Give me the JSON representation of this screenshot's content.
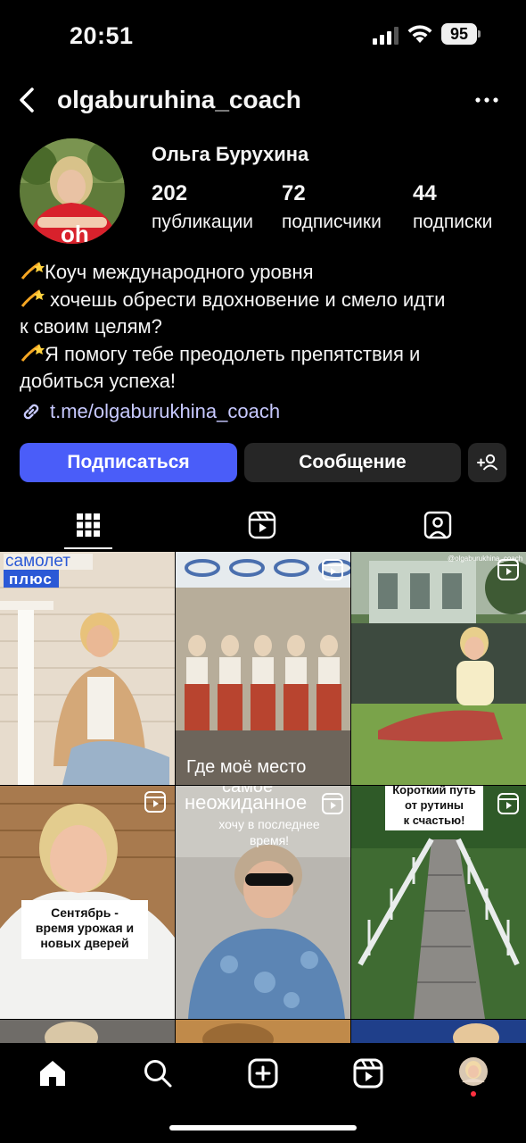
{
  "status": {
    "time": "20:51",
    "battery": "95"
  },
  "header": {
    "username": "olgaburuhina_coach"
  },
  "profile": {
    "name": "Ольга Бурухина",
    "stats": [
      {
        "value": "202",
        "label": "публикации"
      },
      {
        "value": "72",
        "label": "подписчики"
      },
      {
        "value": "44",
        "label": "подписки"
      }
    ],
    "bio": [
      "Коуч международного уровня",
      " хочешь обрести вдохновение и смело идти",
      "к своим целям?",
      "Я помогу тебе преодолеть препятствия и",
      "добиться успеха!"
    ],
    "bio_emoji": "dizzy-star-icon",
    "link": "t.me/olgaburukhina_coach"
  },
  "actions": {
    "follow": "Подписаться",
    "message": "Сообщение"
  },
  "tabs": [
    "grid-icon",
    "reels-icon",
    "tagged-icon"
  ],
  "grid": {
    "captions": {
      "c1_line1": "самолет",
      "c1_line2": "плюс",
      "c2": "Где моё место",
      "c3_watermark": "@olgaburukhina_coach",
      "c4": [
        "Сентябрь -",
        "время урожая и",
        "новых дверей"
      ],
      "c5_title": "самое",
      "c5_word": "неожиданное",
      "c5_sub": [
        "хочу  в  последнее",
        "время!"
      ],
      "c6": [
        "Короткий путь",
        "от рутины",
        "к счастью!"
      ]
    }
  },
  "colors": {
    "accent": "#4a5df9",
    "link": "#c7c9ff",
    "dark_button": "#262626"
  }
}
